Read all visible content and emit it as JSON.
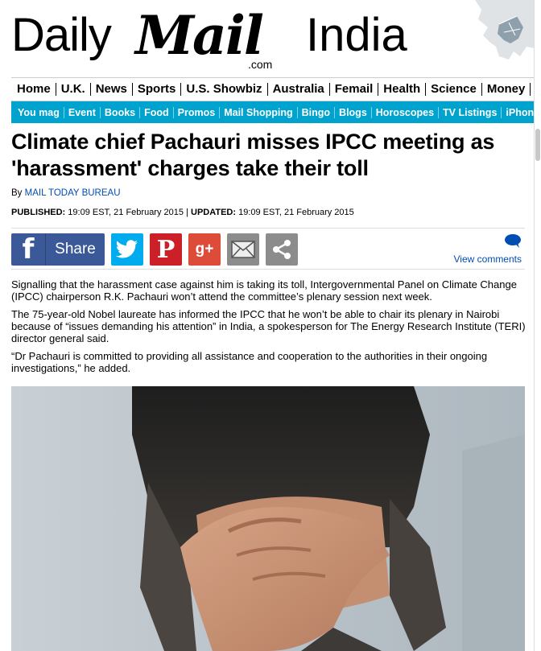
{
  "masthead": {
    "daily": "Daily",
    "mail": "Mail",
    "dotcom": ".com",
    "edition": "India"
  },
  "nav_primary": [
    "Home",
    "U.K.",
    "News",
    "Sports",
    "U.S. Showbiz",
    "Australia",
    "Femail",
    "Health",
    "Science",
    "Money"
  ],
  "nav_secondary": [
    "You mag",
    "Event",
    "Books",
    "Food",
    "Promos",
    "Mail Shopping",
    "Bingo",
    "Blogs",
    "Horoscopes",
    "TV Listings",
    "iPhone"
  ],
  "article": {
    "headline": "Climate chief Pachauri misses IPCC meeting as 'harassment' charges take their toll",
    "by_prefix": "By",
    "author": "MAIL TODAY BUREAU",
    "published_label": "PUBLISHED:",
    "published": "19:09 EST, 21 February 2015",
    "separator": "|",
    "updated_label": "UPDATED:",
    "updated": "19:09 EST, 21 February 2015",
    "paragraphs": [
      "Signalling that the harassment case against him is taking its toll, Intergovernmental Panel on Climate Change (IPCC) chairperson R.K. Pachauri won’t attend the committee’s plenary session next week.",
      "The 75-year-old Nobel laureate has informed the IPCC that he won’t be able to chair its plenary in Nairobi because of “issues demanding his attention” in India, a spokesperson for The Energy Research Institute (TERI) director general said.",
      "“Dr Pachauri is committed to providing all assistance and cooperation to the authorities in their ongoing investigations,” he added."
    ]
  },
  "share": {
    "facebook_label": "Share",
    "view_comments": "View comments",
    "icons": [
      "facebook-icon",
      "twitter-icon",
      "pinterest-icon",
      "google-plus-icon",
      "email-icon",
      "share-icon",
      "comment-bubble-icon"
    ]
  },
  "colors": {
    "nav_secondary_bg": "#00a2ce",
    "link": "#004db3",
    "facebook": "#3b5998",
    "twitter": "#00aced",
    "pinterest": "#cb2027",
    "google_plus": "#dd4b39"
  }
}
